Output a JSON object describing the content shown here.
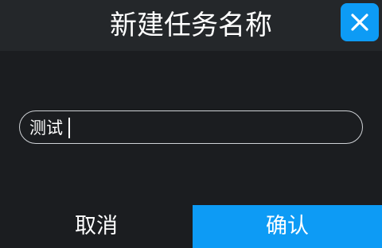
{
  "dialog": {
    "title": "新建任务名称",
    "close_icon": "close-icon",
    "accent_color": "#0d9bf5",
    "background_color": "#1b1d20"
  },
  "name_input": {
    "value": "测试"
  },
  "buttons": {
    "cancel_label": "取消",
    "confirm_label": "确认"
  }
}
